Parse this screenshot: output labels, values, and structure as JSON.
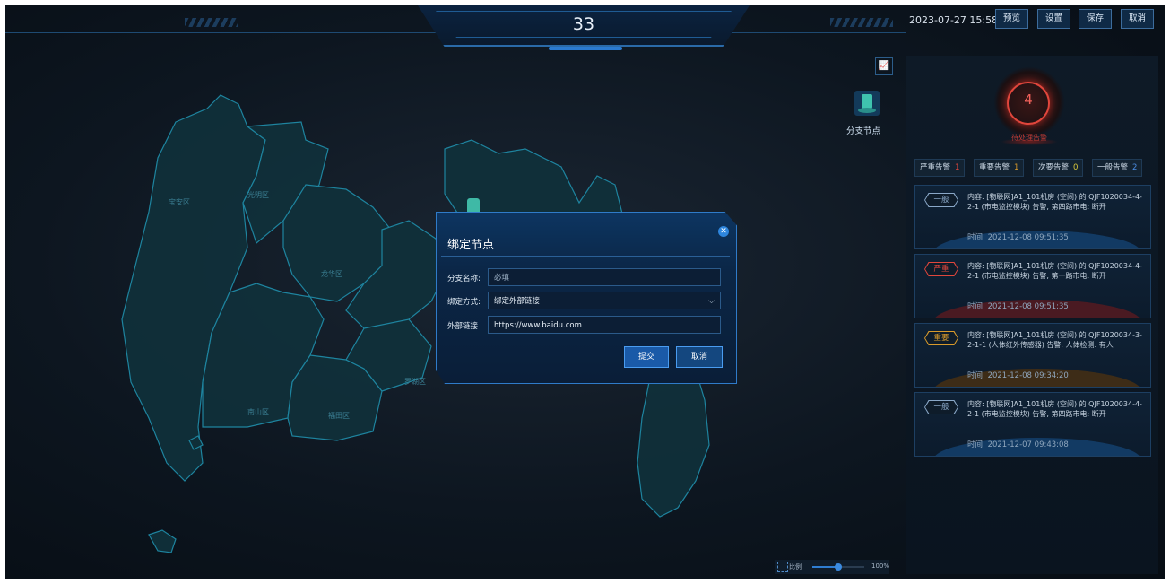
{
  "header": {
    "title": "33",
    "datetime": "2023-07-27  15:58",
    "buttons": [
      "预览",
      "设置",
      "保存",
      "取消"
    ]
  },
  "map": {
    "districts": [
      "宝安区",
      "光明区",
      "龙华区",
      "南山区",
      "福田区",
      "罗湖区"
    ]
  },
  "branch_node": {
    "label": "分支节点"
  },
  "alarm_panel": {
    "pending_count": "4",
    "pending_label": "待处理告警",
    "counters": [
      {
        "label": "严重告警",
        "value": "1",
        "color": "#e0463c"
      },
      {
        "label": "重要告警",
        "value": "1",
        "color": "#d99a2b"
      },
      {
        "label": "次要告警",
        "value": "0",
        "color": "#d9c83a"
      },
      {
        "label": "一般告警",
        "value": "2",
        "color": "#4a8be0"
      }
    ],
    "cards": [
      {
        "level": "一般",
        "level_color": "#8aa8c8",
        "content": "内容: [物联网]A1_101机房 (空间) 的 QJF1020034-4-2-1 (市电监控模块) 告警, 第四路市电: 断开",
        "time": "时间: 2021-12-08 09:51:35",
        "glow": "#123a63"
      },
      {
        "level": "严重",
        "level_color": "#e0463c",
        "content": "内容: [物联网]A1_101机房 (空间) 的 QJF1020034-4-2-1 (市电监控模块) 告警, 第一路市电: 断开",
        "time": "时间: 2021-12-08 09:51:35",
        "glow": "#4a1a22"
      },
      {
        "level": "重要",
        "level_color": "#d99a2b",
        "content": "内容: [物联网]A1_101机房 (空间) 的 QJF1020034-3-2-1-1 (人体红外传感器) 告警, 人体检测: 有人",
        "time": "时间: 2021-12-08 09:34:20",
        "glow": "#3d2c17"
      },
      {
        "level": "一般",
        "level_color": "#8aa8c8",
        "content": "内容: [物联网]A1_101机房 (空间) 的 QJF1020034-4-2-1 (市电监控模块) 告警, 第四路市电: 断开",
        "time": "时间: 2021-12-07 09:43:08",
        "glow": "#123a63"
      }
    ]
  },
  "dialog": {
    "title": "绑定节点",
    "fields": [
      {
        "label": "分支名称:",
        "value": "必填"
      },
      {
        "label": "绑定方式:",
        "value": "绑定外部链接"
      },
      {
        "label": "外部链接",
        "value": "https://www.baidu.com"
      }
    ],
    "submit": "提交",
    "cancel": "取消"
  },
  "zoom": {
    "label": "比例",
    "value": "100%",
    "level": 0.5
  }
}
